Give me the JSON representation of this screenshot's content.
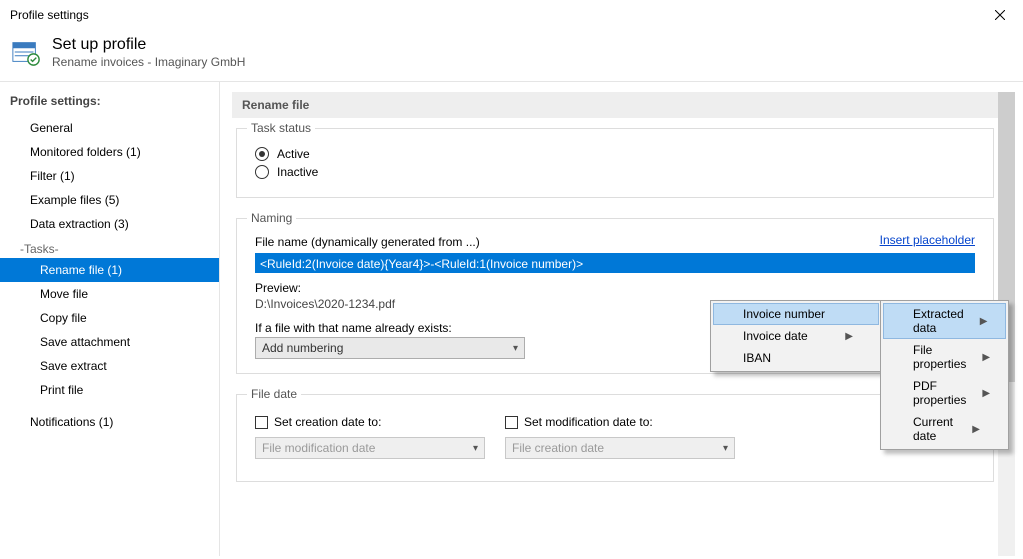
{
  "window": {
    "title": "Profile settings"
  },
  "header": {
    "title": "Set up profile",
    "subtitle": "Rename invoices - Imaginary GmbH"
  },
  "sidebar": {
    "heading": "Profile settings:",
    "items": [
      {
        "label": "General"
      },
      {
        "label": "Monitored folders (1)"
      },
      {
        "label": "Filter (1)"
      },
      {
        "label": "Example files (5)"
      },
      {
        "label": "Data extraction (3)"
      }
    ],
    "tasks_label": "-Tasks-",
    "tasks": [
      {
        "label": "Rename file (1)",
        "selected": true
      },
      {
        "label": "Move file"
      },
      {
        "label": "Copy file"
      },
      {
        "label": "Save attachment"
      },
      {
        "label": "Save extract"
      },
      {
        "label": "Print file"
      }
    ],
    "footer": [
      {
        "label": "Notifications (1)"
      }
    ]
  },
  "section": {
    "title": "Rename file"
  },
  "task_status": {
    "legend": "Task status",
    "active": "Active",
    "inactive": "Inactive",
    "value": "Active"
  },
  "naming": {
    "legend": "Naming",
    "filename_label": "File name (dynamically generated from ...)",
    "insert_placeholder": "Insert placeholder",
    "filename_value": "<RuleId:2(Invoice date){Year4}>-<RuleId:1(Invoice number)>",
    "preview_label": "Preview:",
    "preview_value": "D:\\Invoices\\2020-1234.pdf",
    "exists_label": "If a file with that name already exists:",
    "exists_value": "Add numbering"
  },
  "file_date": {
    "legend": "File date",
    "set_creation": "Set creation date to:",
    "set_modification": "Set modification date to:",
    "creation_value": "File modification date",
    "modification_value": "File creation date"
  },
  "menu_main": {
    "items": [
      {
        "label": "Extracted data",
        "submenu": true,
        "highlight": true
      },
      {
        "label": "File properties",
        "submenu": true
      },
      {
        "label": "PDF properties",
        "submenu": true
      },
      {
        "label": "Current date",
        "submenu": true
      }
    ]
  },
  "menu_sub": {
    "items": [
      {
        "label": "Invoice number",
        "highlight": true
      },
      {
        "label": "Invoice date",
        "submenu": true
      },
      {
        "label": "IBAN"
      }
    ]
  }
}
